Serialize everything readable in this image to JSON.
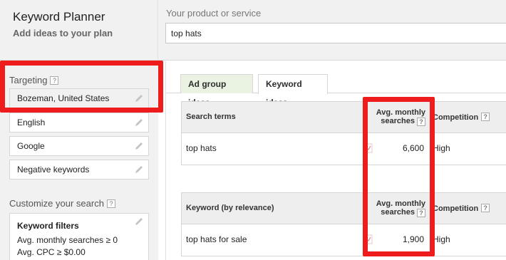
{
  "header": {
    "title": "Keyword Planner",
    "subtitle": "Add ideas to your plan",
    "product_label": "Your product or service",
    "product_value": "top hats"
  },
  "sidebar": {
    "targeting_title": "Targeting",
    "help_glyph": "?",
    "targeting_items": [
      {
        "label": "Bozeman, United States"
      },
      {
        "label": "English"
      },
      {
        "label": "Google"
      },
      {
        "label": "Negative keywords"
      }
    ],
    "customize_title": "Customize your search",
    "filters": {
      "title": "Keyword filters",
      "lines": [
        "Avg. monthly searches ≥ 0",
        "Avg. CPC ≥ $0.00"
      ]
    }
  },
  "tabs": [
    {
      "label": "Ad group ideas",
      "active": false
    },
    {
      "label": "Keyword ideas",
      "active": true
    }
  ],
  "search_terms_table": {
    "col_term": "Search terms",
    "col_avg": "Avg. monthly searches",
    "col_competition": "Competition",
    "rows": [
      {
        "term": "top hats",
        "avg": "6,600",
        "competition": "High"
      }
    ]
  },
  "keyword_table": {
    "col_term": "Keyword (by relevance)",
    "col_avg": "Avg. monthly searches",
    "col_competition": "Competition",
    "rows": [
      {
        "term": "top hats for sale",
        "avg": "1,900",
        "competition": "High"
      }
    ]
  },
  "icons": {
    "edit": "pencil-icon",
    "trend": "trend-chart-icon",
    "help": "help-question-icon"
  },
  "colors": {
    "highlight": "#ee1c1c",
    "tab_inactive": "#eaf3e2",
    "panel_bg": "#f1f1f1"
  }
}
